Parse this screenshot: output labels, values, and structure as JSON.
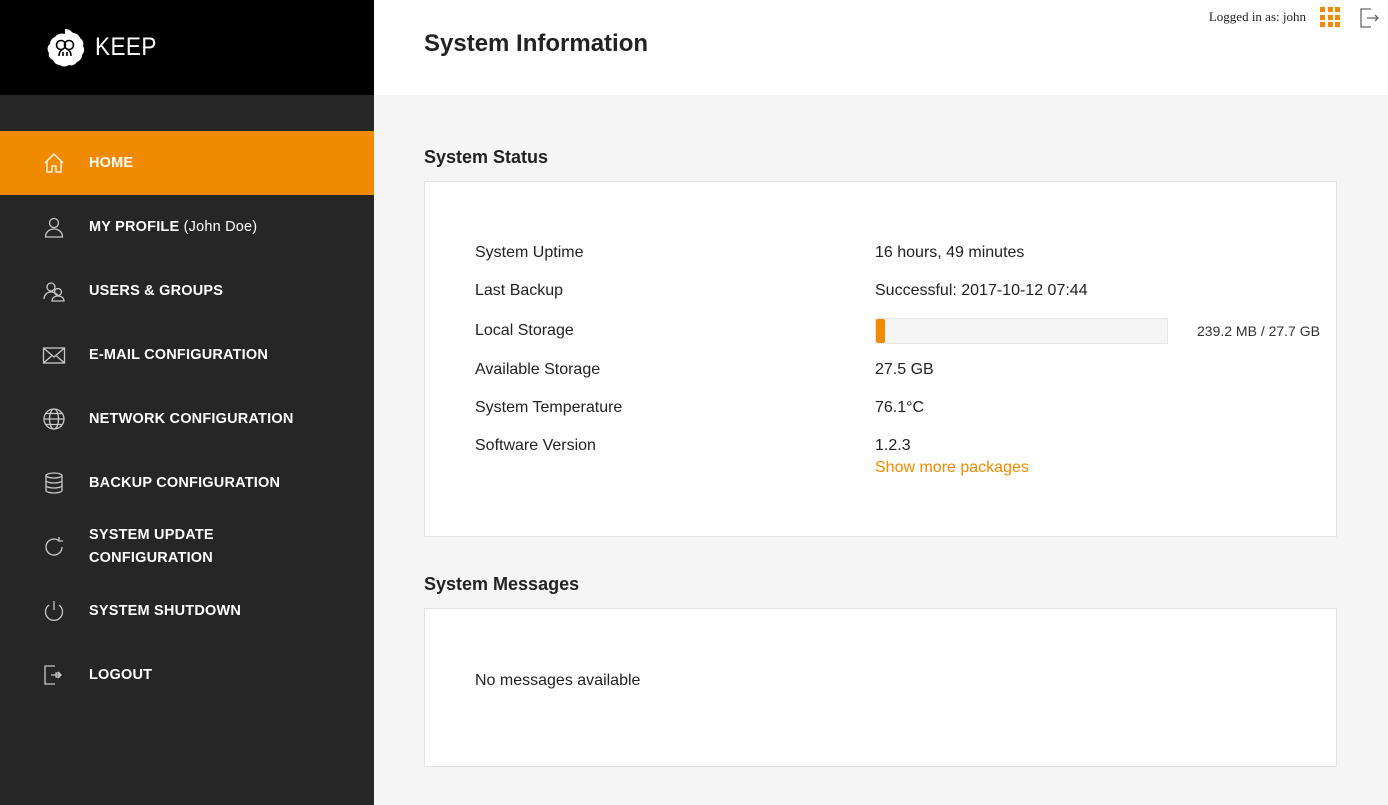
{
  "brand": {
    "name": "KEEP"
  },
  "header": {
    "title": "System Information",
    "login_text": "Logged in as: john"
  },
  "sidebar": {
    "items": [
      {
        "label": "HOME",
        "sub": "",
        "icon": "home-icon",
        "active": true
      },
      {
        "label": "MY PROFILE",
        "sub": " (John Doe)",
        "icon": "user-icon"
      },
      {
        "label": "USERS & GROUPS",
        "sub": "",
        "icon": "users-icon"
      },
      {
        "label": "E-MAIL CONFIGURATION",
        "sub": "",
        "icon": "mail-icon"
      },
      {
        "label": "NETWORK CONFIGURATION",
        "sub": "",
        "icon": "globe-icon"
      },
      {
        "label": "BACKUP CONFIGURATION",
        "sub": "",
        "icon": "database-icon"
      },
      {
        "label": "SYSTEM UPDATE",
        "label2": "CONFIGURATION",
        "icon": "refresh-icon"
      },
      {
        "label": "SYSTEM SHUTDOWN",
        "sub": "",
        "icon": "power-icon"
      },
      {
        "label": "LOGOUT",
        "sub": "",
        "icon": "logout-icon"
      }
    ]
  },
  "status": {
    "title": "System Status",
    "uptime_label": "System Uptime",
    "uptime_value": "16 hours, 49 minutes",
    "backup_label": "Last Backup",
    "backup_value": "Successful: 2017-10-12 07:44",
    "storage_label": "Local Storage",
    "storage_text": "239.2 MB / 27.7 GB",
    "storage_used_fraction": 0.0086,
    "available_label": "Available Storage",
    "available_value": "27.5 GB",
    "temperature_label": "System Temperature",
    "temperature_value": "76.1°C",
    "version_label": "Software Version",
    "version_value": "1.2.3",
    "more_link": "Show more packages"
  },
  "messages": {
    "title": "System Messages",
    "empty_text": "No messages available"
  },
  "colors": {
    "accent": "#f08a00",
    "sidebar_bg": "#262626",
    "brand_bg": "#000000"
  }
}
